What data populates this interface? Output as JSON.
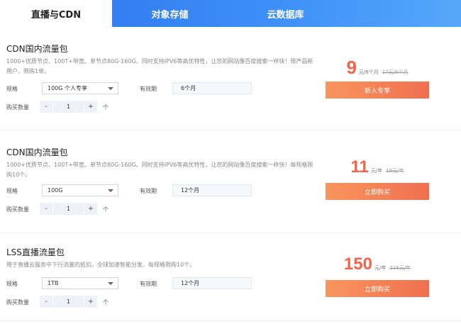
{
  "tabs": [
    {
      "label": "直播与CDN",
      "active": true
    },
    {
      "label": "对象存储",
      "active": false
    },
    {
      "label": "云数据库",
      "active": false
    }
  ],
  "labels": {
    "spec": "规格",
    "period": "有效期",
    "quantity": "购买数量",
    "minus": "-",
    "plus": "+",
    "unit": "个"
  },
  "packages": [
    {
      "title": "CDN国内流量包",
      "desc": "1000+优质节点、100T+带宽、单节点80G-160G、同时支持IPV6等高优特性，让您的网站像百度搜索一样快！限产品新用户，限购1单。",
      "spec": "100G 个人专享",
      "period": "6个月",
      "quantity": "1",
      "price": "9",
      "price_unit": "元/6个月",
      "original_price": "17元/6个月",
      "button": "新人专享"
    },
    {
      "title": "CDN国内流量包",
      "desc": "1000+优质节点、100T+带宽、单节点80G-160G、同时支持IPV6等高优特性，让您的网站像百度搜索一样快！每规格限购10个。",
      "spec": "100G",
      "period": "12个月",
      "quantity": "1",
      "price": "11",
      "price_unit": "元/年",
      "original_price": "19元/年",
      "button": "立即购买"
    },
    {
      "title": "LSS直播流量包",
      "desc": "用于直播云服务中下行流量的抵扣。全球加速智能分发，每规格限购10个。",
      "spec": "1TB",
      "period": "12个月",
      "quantity": "1",
      "price": "150",
      "price_unit": "元/年",
      "original_price": "216元/年",
      "button": "立即购买"
    }
  ],
  "colors": {
    "tab_gradient_start": "#2c72ee",
    "tab_gradient_end": "#56a7fb",
    "price": "#f4644a",
    "button_start": "#f9955e",
    "button_end": "#f07050"
  }
}
